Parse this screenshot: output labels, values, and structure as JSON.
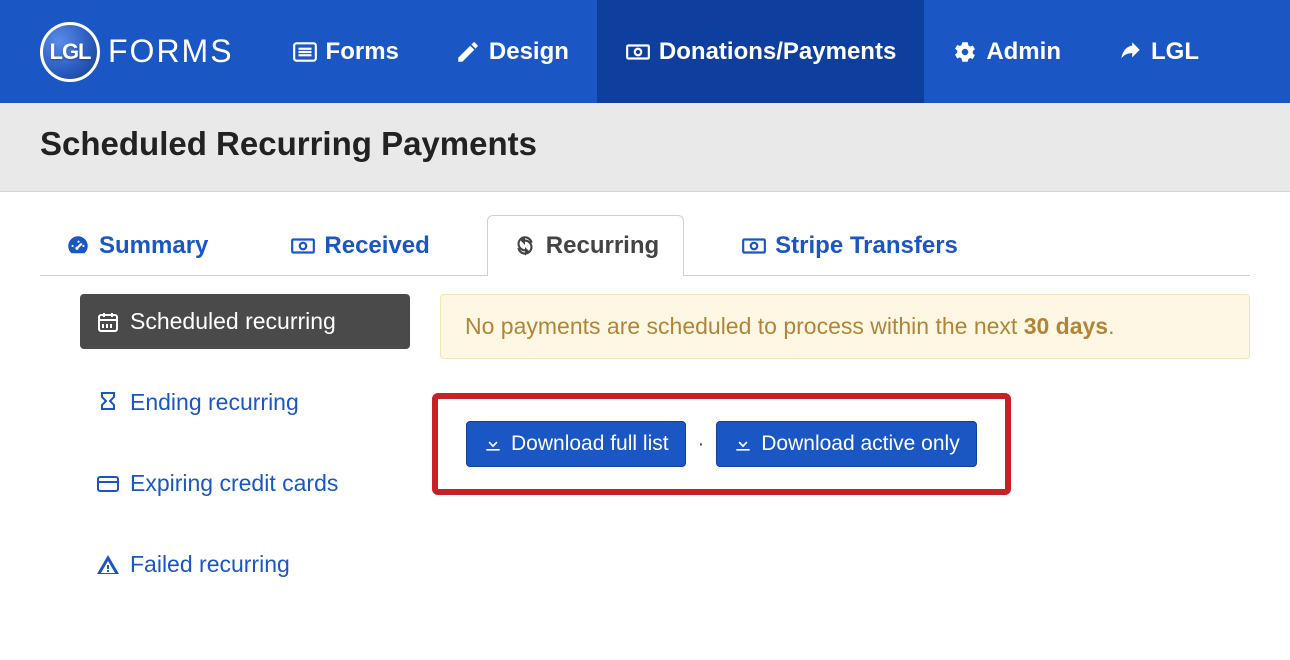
{
  "brand": {
    "badge_text": "LGL",
    "product_text": "FORMS"
  },
  "nav": {
    "items": [
      {
        "label": "Forms"
      },
      {
        "label": "Design"
      },
      {
        "label": "Donations/Payments",
        "active": true
      },
      {
        "label": "Admin"
      },
      {
        "label": "LGL"
      }
    ]
  },
  "page_title": "Scheduled Recurring Payments",
  "tabs": {
    "items": [
      {
        "label": "Summary"
      },
      {
        "label": "Received"
      },
      {
        "label": "Recurring",
        "active": true
      },
      {
        "label": "Stripe Transfers"
      }
    ]
  },
  "side_nav": {
    "items": [
      {
        "label": "Scheduled recurring",
        "active": true
      },
      {
        "label": "Ending recurring"
      },
      {
        "label": "Expiring credit cards"
      },
      {
        "label": "Failed recurring"
      }
    ]
  },
  "alert": {
    "prefix": "No payments are scheduled to process within the next ",
    "bold": "30 days",
    "suffix": "."
  },
  "buttons": {
    "download_full": "Download full list",
    "download_active": "Download active only"
  },
  "colors": {
    "brand_blue": "#1a56c4",
    "brand_blue_dark": "#0f3f9e",
    "highlight_red": "#c72025",
    "alert_bg": "#fdf7e3",
    "alert_text": "#b0853a"
  }
}
